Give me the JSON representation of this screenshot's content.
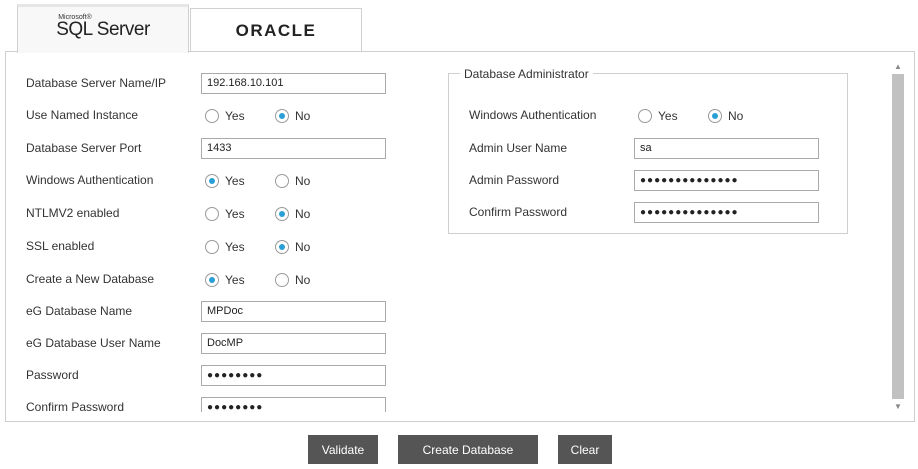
{
  "tabs": {
    "sql": {
      "ms": "Microsoft®",
      "name": "SQL Server"
    },
    "oracle": {
      "name": "ORACLE"
    }
  },
  "form": {
    "server_name": {
      "label": "Database Server Name/IP",
      "value": "192.168.10.101"
    },
    "named_instance": {
      "label": "Use Named Instance",
      "yes": "Yes",
      "no": "No",
      "selected": "No"
    },
    "port": {
      "label": "Database Server Port",
      "value": "1433"
    },
    "windows_auth": {
      "label": "Windows Authentication",
      "yes": "Yes",
      "no": "No",
      "selected": "Yes"
    },
    "ntlmv2": {
      "label": "NTLMV2 enabled",
      "yes": "Yes",
      "no": "No",
      "selected": "No"
    },
    "ssl": {
      "label": "SSL enabled",
      "yes": "Yes",
      "no": "No",
      "selected": "No"
    },
    "create_db": {
      "label": "Create a New Database",
      "yes": "Yes",
      "no": "No",
      "selected": "Yes"
    },
    "db_name": {
      "label": "eG Database Name",
      "value": "MPDoc"
    },
    "db_user": {
      "label": "eG Database User Name",
      "value": "DocMP"
    },
    "password": {
      "label": "Password",
      "value": "●●●●●●●●"
    },
    "confirm_password": {
      "label": "Confirm Password",
      "value": "●●●●●●●●"
    }
  },
  "admin": {
    "legend": "Database Administrator",
    "windows_auth": {
      "label": "Windows Authentication",
      "yes": "Yes",
      "no": "No",
      "selected": "No"
    },
    "user": {
      "label": "Admin User Name",
      "value": "sa"
    },
    "password": {
      "label": "Admin Password",
      "value": "●●●●●●●●●●●●●●"
    },
    "confirm": {
      "label": "Confirm Password",
      "value": "●●●●●●●●●●●●●●"
    }
  },
  "buttons": {
    "validate": "Validate",
    "create": "Create Database",
    "clear": "Clear"
  },
  "colors": {
    "radio_selected": "#2a9fd6",
    "button_bg": "#555555"
  }
}
